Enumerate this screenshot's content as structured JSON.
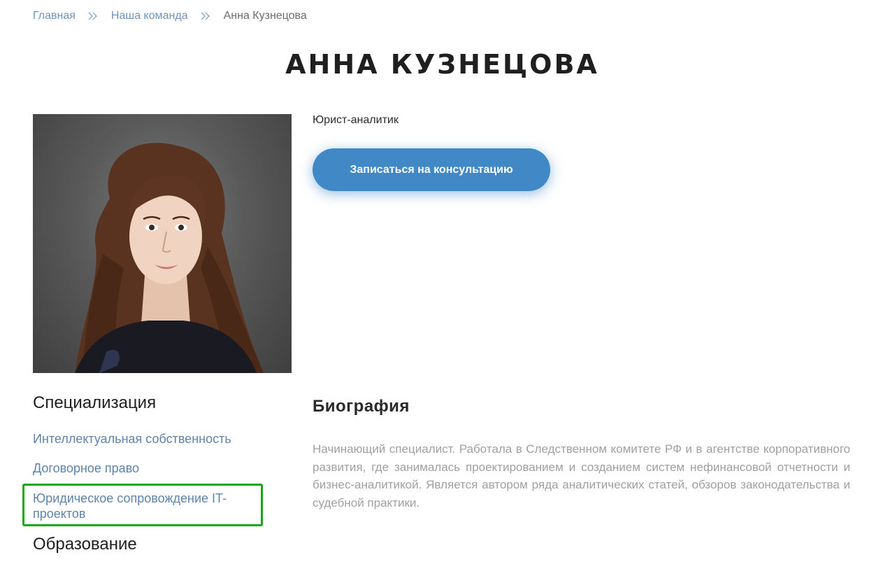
{
  "breadcrumb": {
    "items": [
      {
        "label": "Главная"
      },
      {
        "label": "Наша команда"
      },
      {
        "label": "Анна Кузнецова"
      }
    ]
  },
  "page_title": "АННА КУЗНЕЦОВА",
  "profile": {
    "position": "Юрист-аналитик",
    "consult_button_label": "Записаться на консультацию"
  },
  "specialization": {
    "heading": "Специализация",
    "items": [
      {
        "label": "Интеллектуальная собственность"
      },
      {
        "label": "Договорное право"
      },
      {
        "label": "Юридическое сопровождение IT-проектов"
      }
    ]
  },
  "education": {
    "heading": "Образование"
  },
  "biography": {
    "heading": "Биография",
    "text": "Начинающий специалист. Работала в Следственном комитете РФ и в агентстве корпоративного развития, где занималась проектированием и созданием систем нефинансовой отчетности и бизнес-аналитикой. Является автором ряда аналитических статей, обзоров законодательства и судебной практики."
  },
  "colors": {
    "accent": "#4189c6",
    "link": "#5f83aa",
    "highlight": "#15a815"
  },
  "icons": {
    "breadcrumb_separator": "double-chevron-right-icon"
  }
}
